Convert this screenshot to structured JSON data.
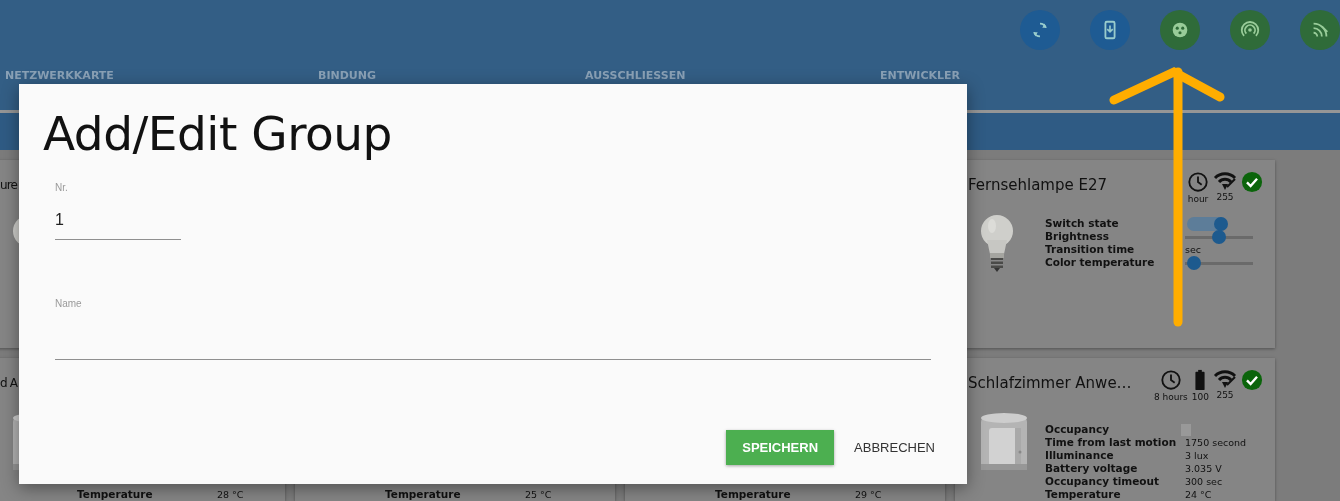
{
  "header": {
    "actions": [
      {
        "kind": "sync",
        "color": "#1e5b93"
      },
      {
        "kind": "phone",
        "color": "#1e5b93"
      },
      {
        "kind": "dots",
        "color": "#2f6b39"
      },
      {
        "kind": "wireless",
        "color": "#2f6b39"
      },
      {
        "kind": "feed",
        "color": "#2f6b39"
      }
    ]
  },
  "tabs": [
    {
      "label": "NETZWERKKARTE"
    },
    {
      "label": "BINDUNG"
    },
    {
      "label": "AUSSCHLIESSEN"
    },
    {
      "label": "ENTWICKLER"
    }
  ],
  "rows": [
    {
      "cards": [
        {
          "title": "ure",
          "image": {
            "kind": "picture"
          }
        },
        {
          "title": "Fernsehlampe E27",
          "image": {
            "kind": "picture"
          },
          "status": [
            {
              "kind": "clock",
              "text": "hour"
            },
            {
              "kind": "signal",
              "text": "255"
            },
            {
              "kind": "ok"
            }
          ],
          "properties": [
            {
              "label": "Switch state",
              "kind": "toggle",
              "on": true
            },
            {
              "label": "Brightness",
              "kind": "slider",
              "level": 0.5
            },
            {
              "label": "Transition time",
              "kind": "text",
              "value": "sec"
            },
            {
              "label": "Color temperature",
              "kind": "slider",
              "level": 0.03
            }
          ]
        }
      ]
    },
    {
      "cards": [
        {
          "title": "d A",
          "image": {
            "kind": "picture"
          },
          "properties": [
            {
              "label": "Temperature",
              "kind": "text",
              "value": "28 °C"
            }
          ]
        },
        {
          "properties": [
            {
              "label": "Temperature",
              "kind": "text",
              "value": "25 °C"
            }
          ]
        },
        {
          "properties": [
            {
              "label": "Temperature",
              "kind": "text",
              "value": "29 °C"
            }
          ]
        },
        {
          "title": "Schlafzimmer Anwe…",
          "image": {
            "kind": "picture"
          },
          "status": [
            {
              "kind": "clock",
              "text": "8 hours"
            },
            {
              "kind": "battery",
              "text": "100"
            },
            {
              "kind": "signal",
              "text": "255"
            },
            {
              "kind": "ok"
            }
          ],
          "properties": [
            {
              "label": "Occupancy",
              "kind": "checkbox",
              "checked": false
            },
            {
              "label": "Time from last motion",
              "kind": "text",
              "value": "1750 second"
            },
            {
              "label": "Illuminance",
              "kind": "text",
              "value": "3 lux"
            },
            {
              "label": "Battery voltage",
              "kind": "text",
              "value": "3.035 V"
            },
            {
              "label": "Occupancy timeout",
              "kind": "text",
              "value": "300 sec"
            },
            {
              "label": "Temperature",
              "kind": "text",
              "value": "24 °C"
            }
          ]
        }
      ]
    }
  ],
  "dialog": {
    "title": "Add/Edit Group",
    "fields": [
      {
        "label": "Nr.",
        "value": "1"
      },
      {
        "label": "Name"
      }
    ],
    "buttons": [
      {
        "label": "SPEICHERN",
        "kind": "primary"
      },
      {
        "label": "ABBRECHEN",
        "kind": "flat"
      }
    ]
  },
  "annotation": {
    "kind": "arrow"
  }
}
